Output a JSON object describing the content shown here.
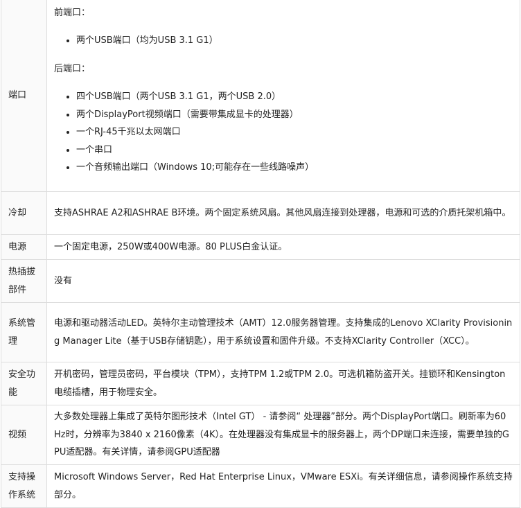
{
  "rows": {
    "ports": {
      "label": "端口",
      "front_heading": "前端口：",
      "front_items": [
        "两个USB端口（均为USB 3.1 G1）"
      ],
      "rear_heading": "后端口：",
      "rear_items": [
        "四个USB端口（两个USB 3.1 G1，两个USB 2.0）",
        "两个DisplayPort视频端口（需要带集成显卡的处理器）",
        "一个RJ-45千兆以太网端口",
        "一个串口",
        "一个音频输出端口（Windows 10;可能存在一些线路噪声）"
      ]
    },
    "cooling": {
      "label": "冷却",
      "value": "支持ASHRAE A2和ASHRAE B环境。两个固定系统风扇。其他风扇连接到处理器，电源和可选的介质托架机箱中。"
    },
    "power": {
      "label": "电源",
      "value": "一个固定电源，250W或400W电源。80 PLUS白金认证。"
    },
    "hotswap": {
      "label": "热插拔部件",
      "value": "没有"
    },
    "management": {
      "label": "系统管理",
      "value": "电源和驱动器活动LED。英特尔主动管理技术（AMT）12.0服务器管理。支持集成的Lenovo XClarity Provisioning Manager Lite（基于USB存储钥匙），用于系统设置和固件升级。不支持XClarity Controller（XCC）。"
    },
    "security": {
      "label": "安全功能",
      "value": "开机密码，管理员密码，平台模块（TPM），支持TPM 1.2或TPM 2.0。可选机箱防盗开关。挂锁环和Kensington电缆插槽，用于物理安全。"
    },
    "video": {
      "label": "视频",
      "value": "大多数处理器上集成了英特尔图形技术（Intel GT） - 请参阅“ 处理器”部分。两个DisplayPort端口。刷新率为60Hz时，分辨率为3840 x 2160像素（4K）。在处理器没有集成显卡的服务器上，两个DP端口未连接，需要单独的GPU适配器。有关详情，请参阅GPU适配器"
    },
    "os": {
      "label": "支持操作系统",
      "value": "Microsoft Windows Server，Red Hat Enterprise Linux，VMware ESXi。有关详细信息，请参阅操作系统支持部分。"
    }
  }
}
